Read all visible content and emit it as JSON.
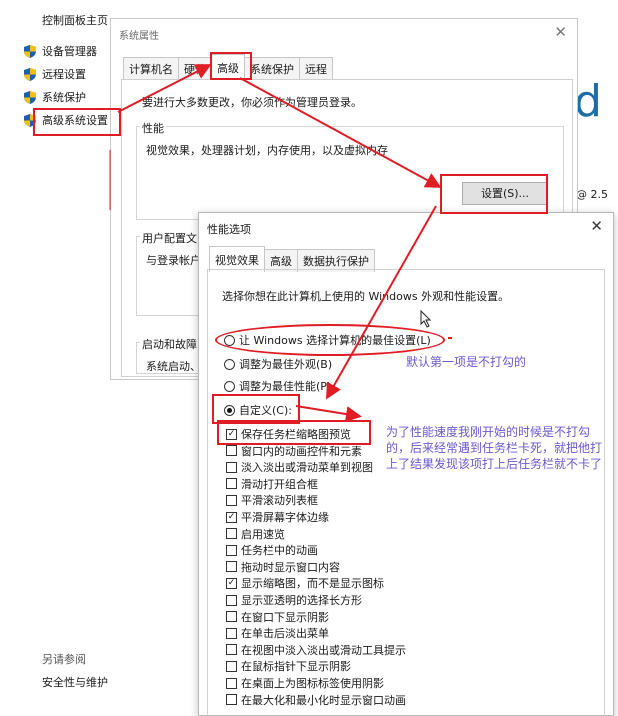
{
  "control_panel": {
    "home_link": "控制面板主页",
    "items": [
      {
        "label": "设备管理器",
        "icon": "shield-icon"
      },
      {
        "label": "远程设置",
        "icon": "shield-icon"
      },
      {
        "label": "系统保护",
        "icon": "shield-icon"
      },
      {
        "label": "高级系统设置",
        "icon": "shield-icon"
      }
    ],
    "see_also": "另请参阅",
    "security_link": "安全性与维护"
  },
  "system_properties": {
    "title": "系统属性",
    "close": "✕",
    "tabs": [
      "计算机名",
      "硬件",
      "高级",
      "系统保护",
      "远程"
    ],
    "active_tab": "高级",
    "admin_note": "要进行大多数更改，你必须作为管理员登录。",
    "performance_group": "性能",
    "performance_desc": "视觉效果，处理器计划，内存使用，以及虚拟内存",
    "settings_button": "设置(S)...",
    "user_profile_group": "用户配置文",
    "user_profile_desc": "与登录帐户",
    "startup_group": "启动和故障",
    "startup_desc": "系统启动、"
  },
  "background_edge": {
    "big_letter": "d",
    "cpu_snippet": "@ 2.5"
  },
  "performance_options": {
    "title": "性能选项",
    "close": "✕",
    "tabs": [
      "视觉效果",
      "高级",
      "数据执行保护"
    ],
    "active_tab": "视觉效果",
    "prompt": "选择你想在此计算机上使用的 Windows 外观和性能设置。",
    "radios": [
      {
        "label": "让 Windows 选择计算机的最佳设置(L)",
        "selected": false
      },
      {
        "label": "调整为最佳外观(B)",
        "selected": false
      },
      {
        "label": "调整为最佳性能(P)",
        "selected": false
      },
      {
        "label": "自定义(C):",
        "selected": true
      }
    ],
    "checkboxes": [
      {
        "label": "保存任务栏缩略图预览",
        "checked": true
      },
      {
        "label": "窗口内的动画控件和元素",
        "checked": false
      },
      {
        "label": "淡入淡出或滑动菜单到视图",
        "checked": false
      },
      {
        "label": "滑动打开组合框",
        "checked": false
      },
      {
        "label": "平滑滚动列表框",
        "checked": false
      },
      {
        "label": "平滑屏幕字体边缘",
        "checked": true
      },
      {
        "label": "启用速览",
        "checked": false
      },
      {
        "label": "任务栏中的动画",
        "checked": false
      },
      {
        "label": "拖动时显示窗口内容",
        "checked": false
      },
      {
        "label": "显示缩略图，而不是显示图标",
        "checked": true
      },
      {
        "label": "显示亚透明的选择长方形",
        "checked": false
      },
      {
        "label": "在窗口下显示阴影",
        "checked": false
      },
      {
        "label": "在单击后淡出菜单",
        "checked": false
      },
      {
        "label": "在视图中淡入淡出或滑动工具提示",
        "checked": false
      },
      {
        "label": "在鼠标指针下显示阴影",
        "checked": false
      },
      {
        "label": "在桌面上为图标标签使用阴影",
        "checked": false
      },
      {
        "label": "在最大化和最小化时显示窗口动画",
        "checked": false
      }
    ]
  },
  "annotations": {
    "default_note": "默认第一项是不打勾的",
    "explanation": "为了性能速度我刚开始的时候是不打勾的，后来经常遇到任务栏卡死，就把他打上了结果发现该项打上后任务栏就不卡了",
    "color_red": "#e01c24",
    "color_purple": "#6a5acd"
  }
}
